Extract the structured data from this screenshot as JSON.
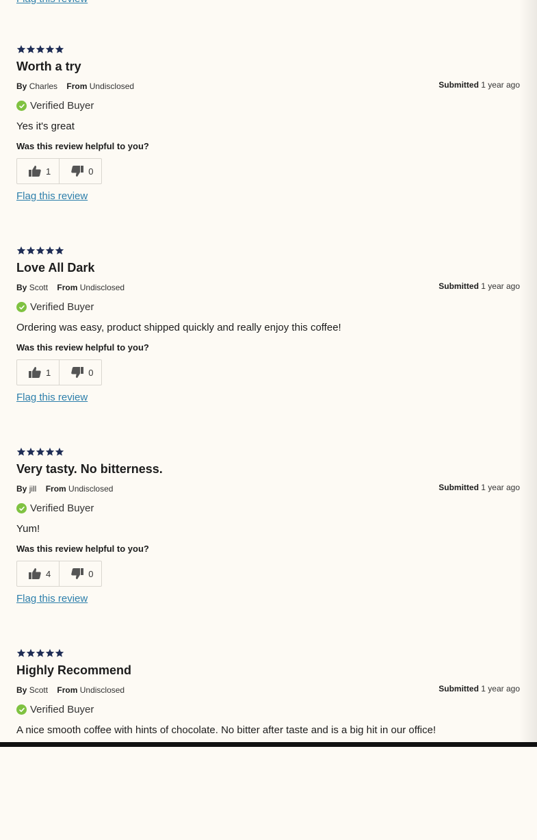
{
  "common": {
    "by_label": "By",
    "from_label": "From",
    "submitted_label": "Submitted",
    "verified_label": "Verified Buyer",
    "helpful_question": "Was this review helpful to you?",
    "flag_label": "Flag this review",
    "star_color": "#1f2d55",
    "verified_color": "#7fc241",
    "link_color": "#2d7fab"
  },
  "reviews": [
    {
      "rating": 5,
      "title": "Worth a try",
      "author": "Charles",
      "location": "Undisclosed",
      "submitted": "1 year ago",
      "body": "Yes it's great",
      "helpful_yes": "1",
      "helpful_no": "0"
    },
    {
      "rating": 5,
      "title": "Love All Dark",
      "author": "Scott",
      "location": "Undisclosed",
      "submitted": "1 year ago",
      "body": "Ordering was easy, product shipped quickly and really enjoy this coffee!",
      "helpful_yes": "1",
      "helpful_no": "0"
    },
    {
      "rating": 5,
      "title": "Very tasty. No bitterness.",
      "author": "jill",
      "location": "Undisclosed",
      "submitted": "1 year ago",
      "body": "Yum!",
      "helpful_yes": "4",
      "helpful_no": "0"
    },
    {
      "rating": 5,
      "title": "Highly Recommend",
      "author": "Scott",
      "location": "Undisclosed",
      "submitted": "1 year ago",
      "body": "A nice smooth coffee with hints of chocolate. No bitter after taste and is a big hit in our office!"
    }
  ]
}
